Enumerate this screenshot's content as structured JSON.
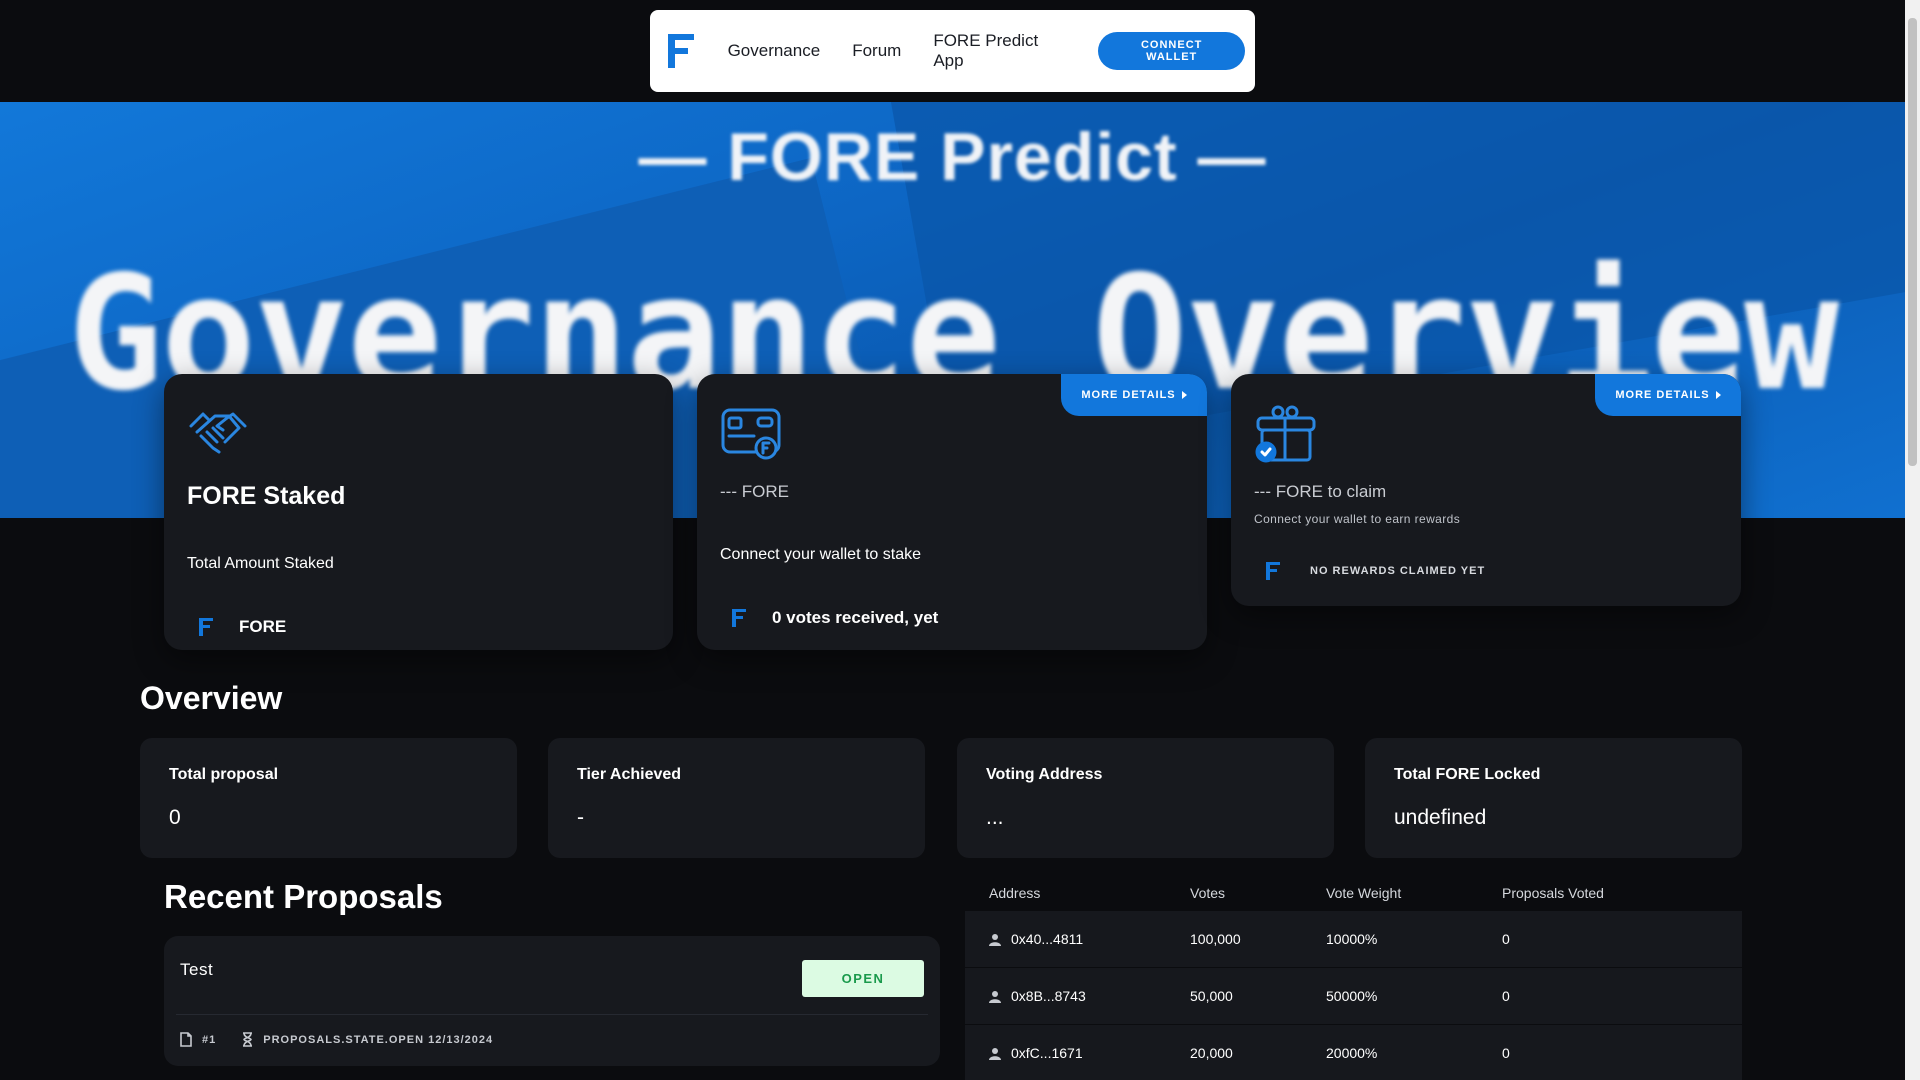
{
  "nav": {
    "links": [
      "Governance",
      "Forum",
      "FORE Predict App"
    ],
    "connect_label": "CONNECT WALLET",
    "logo_icon": "fore-logo-icon"
  },
  "hero": {
    "subtitle": "— FORE Predict —",
    "title": "Governance Overview"
  },
  "cards": {
    "staked": {
      "title": "FORE Staked",
      "subtitle": "Total Amount Staked",
      "value": "FORE",
      "icon": "handshake-icon"
    },
    "stake": {
      "more": "MORE DETAILS",
      "amount": "--- FORE",
      "subtitle": "Connect your wallet to stake",
      "value": "0 votes received, yet",
      "icon": "wallet-card-icon"
    },
    "rewards": {
      "more": "MORE DETAILS",
      "amount": "--- FORE to claim",
      "small": "Connect your wallet to earn rewards",
      "value": "NO REWARDS CLAIMED YET",
      "icon": "gift-icon"
    }
  },
  "overview": {
    "title": "Overview",
    "stats": [
      {
        "label": "Total proposal",
        "value": "0"
      },
      {
        "label": "Tier Achieved",
        "value": "-"
      },
      {
        "label": "Voting Address",
        "value": "..."
      },
      {
        "label": "Total FORE Locked",
        "value": "undefined"
      }
    ]
  },
  "recent": {
    "title": "Recent Proposals",
    "proposal": {
      "name": "Test",
      "status": "OPEN",
      "id": "#1",
      "state": "PROPOSALS.STATE.OPEN 12/13/2024"
    }
  },
  "voters": {
    "headers": [
      "Address",
      "Votes",
      "Vote Weight",
      "Proposals Voted"
    ],
    "rows": [
      {
        "address": "0x40...4811",
        "votes": "100,000",
        "weight": "10000%",
        "voted": "0"
      },
      {
        "address": "0x8B...8743",
        "votes": "50,000",
        "weight": "50000%",
        "voted": "0"
      },
      {
        "address": "0xfC...1671",
        "votes": "20,000",
        "weight": "20000%",
        "voted": "0"
      }
    ]
  },
  "colors": {
    "accent": "#1277dc",
    "card": "#17191e",
    "background": "#0b0c0f",
    "badge_bg": "#dcfbe3",
    "badge_text": "#1a9a4c"
  }
}
